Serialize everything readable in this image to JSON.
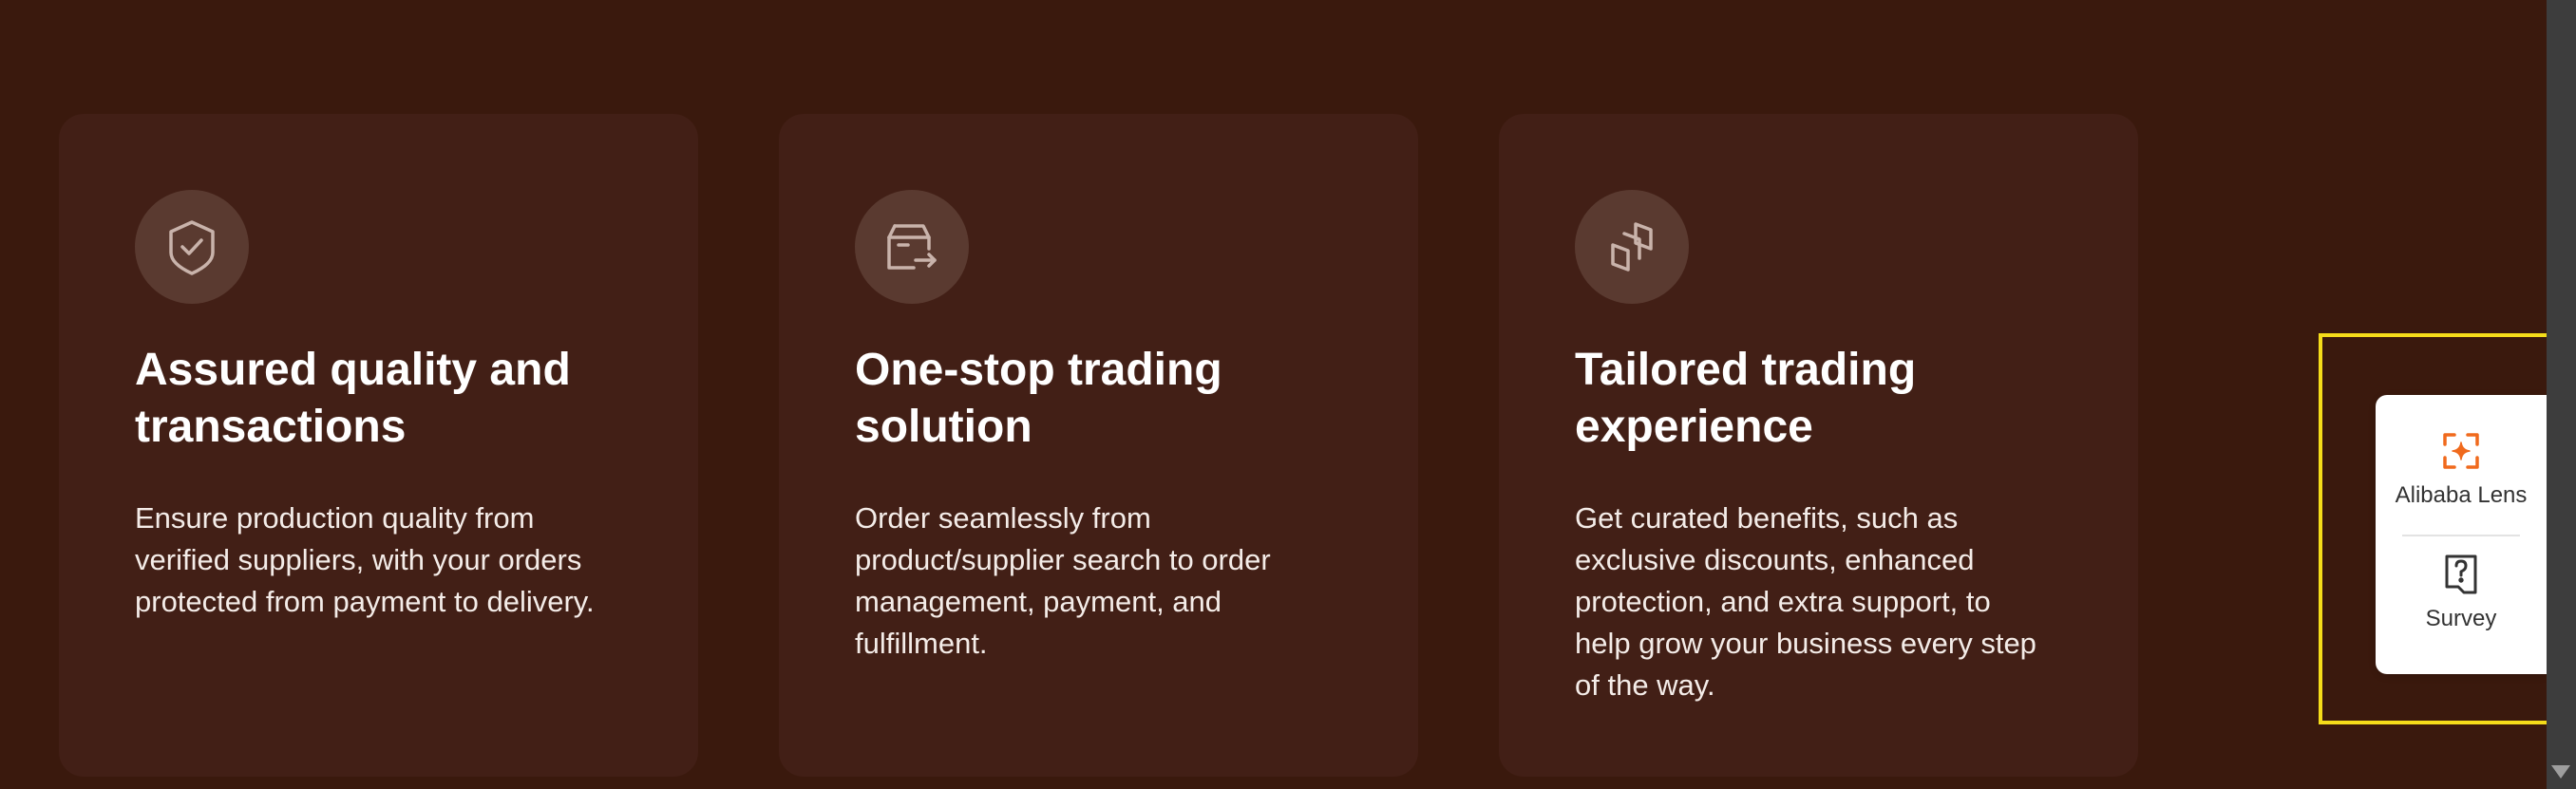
{
  "cards": [
    {
      "icon": "shield-check-icon",
      "title": "Assured quality and transactions",
      "description": "Ensure production quality from verified suppliers, with your orders protected from payment to delivery."
    },
    {
      "icon": "box-arrow-icon",
      "title": "One-stop trading solution",
      "description": "Order seamlessly from product/supplier search to order management, payment, and fulfillment."
    },
    {
      "icon": "tailored-layers-icon",
      "title": "Tailored trading experience",
      "description": "Get curated benefits, such as exclusive discounts, enhanced protection, and extra support, to help grow your business every step of the way."
    }
  ],
  "float_panel": {
    "lens_label": "Alibaba Lens",
    "lens_icon": "lens-scan-icon",
    "survey_label": "Survey",
    "survey_icon": "survey-question-icon"
  },
  "colors": {
    "background": "#3a190d",
    "card": "#421f16",
    "highlight": "#f5dc1a",
    "lens_accent": "#f06a1d"
  }
}
